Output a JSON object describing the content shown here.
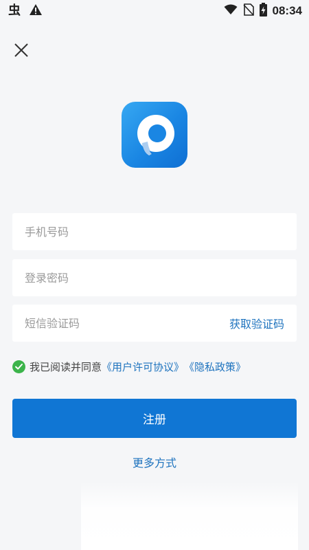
{
  "status_bar": {
    "time": "08:34",
    "icons": [
      "bug-icon",
      "warning-icon",
      "wifi-icon",
      "no-sim-icon",
      "battery-charging-icon"
    ]
  },
  "header": {
    "close_icon": "close-icon"
  },
  "logo": {
    "icon": "app-logo-icon",
    "colors": {
      "primary": "#1a86e3",
      "light": "#37a8f2"
    }
  },
  "form": {
    "phone_placeholder": "手机号码",
    "password_placeholder": "登录密码",
    "sms_placeholder": "短信验证码",
    "get_code_label": "获取验证码"
  },
  "agreement": {
    "checked": true,
    "text": "我已阅读并同意",
    "user_license_link": "《用户许可协议》",
    "privacy_link": "《隐私政策》"
  },
  "register_button": "注册",
  "more_options_link": "更多方式",
  "colors": {
    "accent": "#1076d4",
    "link": "#1e73be",
    "check": "#3cb44b",
    "background": "#f5f6f8"
  }
}
